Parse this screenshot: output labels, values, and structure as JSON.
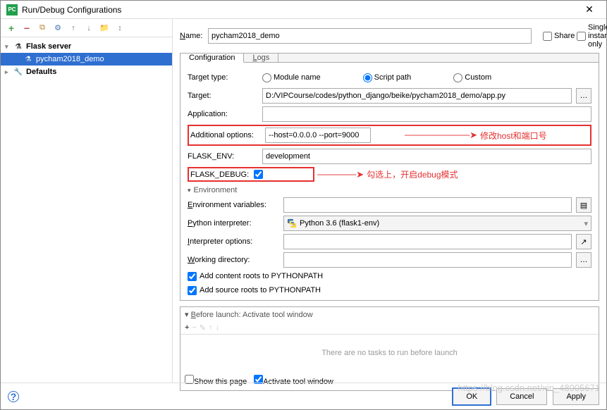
{
  "window": {
    "title": "Run/Debug Configurations"
  },
  "tree": {
    "flask_server": "Flask server",
    "selected_config": "pycham2018_demo",
    "defaults": "Defaults"
  },
  "header": {
    "name_label": "Name:",
    "name_value": "pycham2018_demo",
    "share": "Share",
    "single_instance": "Single instance only"
  },
  "tabs": {
    "configuration": "Configuration",
    "logs": "Logs"
  },
  "form": {
    "target_type_label": "Target type:",
    "target_type_options": {
      "module": "Module name",
      "script": "Script path",
      "custom": "Custom"
    },
    "target_label": "Target:",
    "target_value": "D:/VIPCourse/codes/python_django/beike/pycham2018_demo/app.py",
    "application_label": "Application:",
    "application_value": "",
    "additional_label": "Additional options:",
    "additional_value": "--host=0.0.0.0 --port=9000",
    "flask_env_label": "FLASK_ENV:",
    "flask_env_value": "development",
    "flask_debug_label": "FLASK_DEBUG:",
    "environment_header": "Environment",
    "env_vars_label": "Environment variables:",
    "env_vars_value": "",
    "interpreter_label": "Python interpreter:",
    "interpreter_value": "Python 3.6 (flask1-env)",
    "interp_opts_label": "Interpreter options:",
    "interp_opts_value": "",
    "workdir_label": "Working directory:",
    "workdir_value": "",
    "content_roots": "Add content roots to PYTHONPATH",
    "source_roots": "Add source roots to PYTHONPATH"
  },
  "annotations": {
    "host_port": "修改host和端口号",
    "debug": "勾选上，开启debug模式"
  },
  "before_launch": {
    "header": "Before launch: Activate tool window",
    "empty": "There are no tasks to run before launch",
    "show_page": "Show this page",
    "activate_tool": "Activate tool window"
  },
  "footer": {
    "ok": "OK",
    "cancel": "Cancel",
    "apply": "Apply"
  },
  "watermark": "https://blog.csdn.net/xin_48905671"
}
